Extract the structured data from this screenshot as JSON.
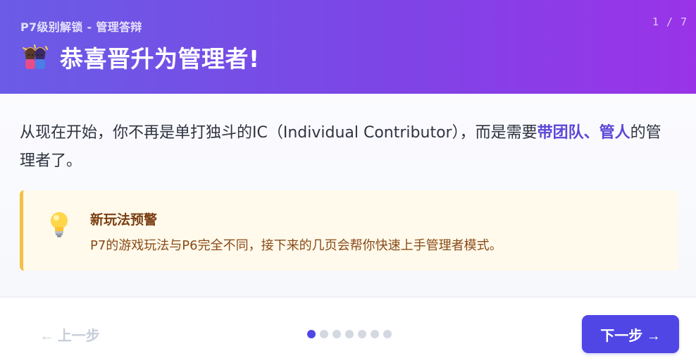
{
  "header": {
    "subtitle": "P7级别解锁 - 管理答辩",
    "counter": "1 / 7",
    "title": "恭喜晋升为管理者!",
    "title_icon": "partying-people-icon"
  },
  "content": {
    "paragraph_part1": "从现在开始，你不再是单打独斗的IC（Individual Contributor），而是需要",
    "paragraph_highlight": "带团队、管人",
    "paragraph_part2": "的管理者了。"
  },
  "notice": {
    "icon": "light-bulb-icon",
    "title": "新玩法预警",
    "text": "P7的游戏玩法与P6完全不同，接下来的几页会帮你快速上手管理者模式。"
  },
  "footer": {
    "prev_label": "← 上一步",
    "next_label": "下一步 →",
    "pagination": {
      "total": 7,
      "current": 1
    }
  },
  "colors": {
    "header_gradient_start": "#6a5ce6",
    "header_gradient_end": "#9a33e8",
    "accent": "#4f46e5",
    "highlight_text": "#5b47d6",
    "notice_bg": "#fffaeb",
    "notice_border": "#f5c042"
  }
}
